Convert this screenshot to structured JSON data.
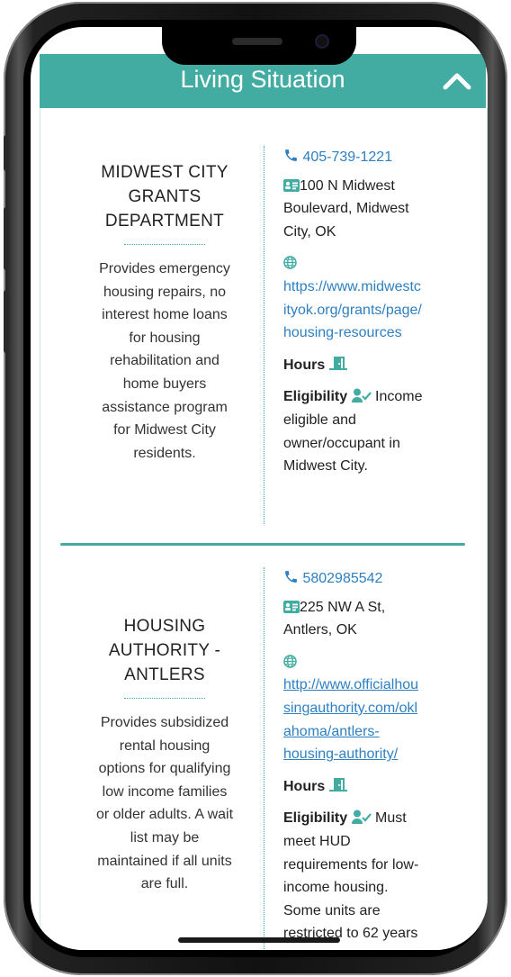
{
  "header": {
    "title": "Living Situation"
  },
  "colors": {
    "accent": "#42aca3",
    "link": "#2f80c2"
  },
  "cards": [
    {
      "name_lines": [
        "MIDWEST CITY",
        "GRANTS",
        "DEPARTMENT"
      ],
      "description_lines": [
        "Provides emergency",
        "housing repairs, no",
        "interest home loans",
        "for housing",
        "rehabilitation and",
        "home buyers",
        "assistance program",
        "for Midwest City",
        "residents."
      ],
      "phone": "405-739-1221",
      "address_lines": [
        "100 N Midwest",
        "Boulevard, Midwest",
        "City, OK"
      ],
      "url_lines": [
        "https://www.midwestc",
        "ityok.org/grants/page/",
        "housing-resources"
      ],
      "hours_label": "Hours",
      "eligibility_label": "Eligibility",
      "eligibility_lines": [
        " Income",
        "eligible and",
        "owner/occupant in",
        "Midwest City."
      ]
    },
    {
      "name_lines": [
        "HOUSING",
        "AUTHORITY -",
        "ANTLERS"
      ],
      "description_lines": [
        "Provides subsidized",
        "rental housing",
        "options for qualifying",
        "low income families",
        "or older adults. A wait",
        "list may be",
        "maintained if all units",
        "are full."
      ],
      "phone": "5802985542",
      "address_lines": [
        "225 NW A St,",
        "Antlers, OK"
      ],
      "url_lines": [
        "http://www.officialhou",
        "singauthority.com/okl",
        "ahoma/antlers-",
        "housing-authority/"
      ],
      "hours_label": "Hours",
      "eligibility_label": "Eligibility",
      "eligibility_lines": [
        " Must",
        "meet HUD",
        "requirements for low-",
        "income housing.",
        "Some units are",
        "restricted to 62 years"
      ]
    }
  ]
}
